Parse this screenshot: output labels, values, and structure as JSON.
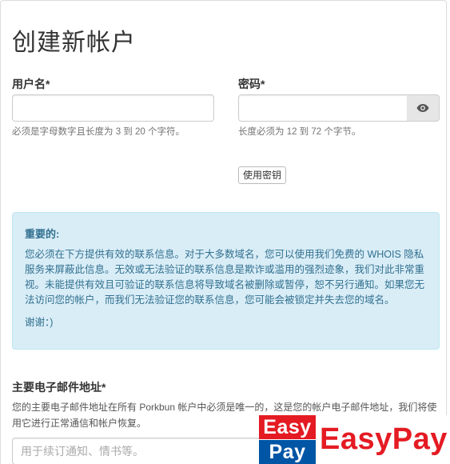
{
  "page": {
    "title": "创建新帐户"
  },
  "username": {
    "label": "用户名*",
    "value": "",
    "help": "必须是字母数字且长度为 3 到 20 个字符。"
  },
  "password": {
    "label": "密码*",
    "value": "",
    "help": "长度必须为 12 到 72 个字节。",
    "toggle_icon": "eye-icon",
    "use_key_button": "使用密钥"
  },
  "notice": {
    "title": "重要的:",
    "body": "您必须在下方提供有效的联系信息。对于大多数域名，您可以使用我们免费的 WHOIS 隐私服务来屏蔽此信息。无效或无法验证的联系信息是欺诈或滥用的强烈迹象，我们对此非常重视。未能提供有效且可验证的联系信息将导致域名被删除或暂停，恕不另行通知。如果您无法访问您的帐户，而我们无法验证您的联系信息，您可能会被锁定并失去您的域名。",
    "thanks": "谢谢：)"
  },
  "email": {
    "label": "主要电子邮件地址*",
    "description": "您的主要电子邮件地址在所有 Porkbun 帐户中必须是唯一的，这是您的帐户电子邮件地址，我们将使用它进行正常通信和帐户恢复。",
    "placeholder": "用于续订通知、情书等。",
    "value": ""
  },
  "watermark": {
    "logo_top": "Easy",
    "logo_bottom": "Pay",
    "text": "EasyPay"
  },
  "colors": {
    "alert_bg": "#d9edf7",
    "alert_text": "#31708f",
    "brand_red": "#e41b23",
    "brand_blue": "#0055a5"
  }
}
